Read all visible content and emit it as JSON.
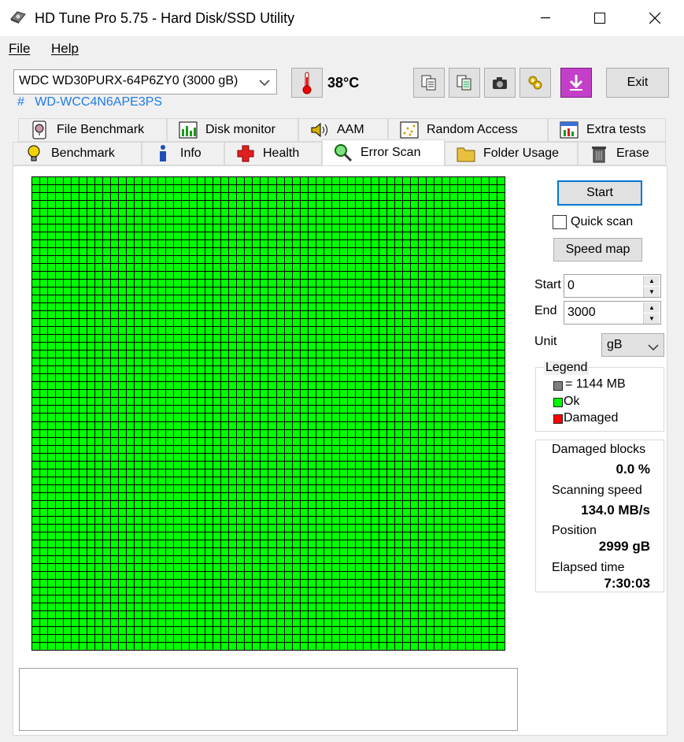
{
  "window": {
    "title": "HD Tune Pro 5.75 - Hard Disk/SSD Utility"
  },
  "menu": {
    "file": "File",
    "help": "Help"
  },
  "drive": {
    "selected": "WDC WD30PURX-64P6ZY0 (3000 gB)",
    "serial_prefix": "#",
    "serial": "WD-WCC4N6APE3PS"
  },
  "temperature": "38°C",
  "toolbar": {
    "exit_label": "Exit"
  },
  "tabs_top": [
    {
      "label": "File Benchmark",
      "icon": "file-benchmark-icon"
    },
    {
      "label": "Disk monitor",
      "icon": "disk-monitor-icon"
    },
    {
      "label": "AAM",
      "icon": "speaker-icon"
    },
    {
      "label": "Random Access",
      "icon": "random-access-icon"
    },
    {
      "label": "Extra tests",
      "icon": "extra-tests-icon"
    }
  ],
  "tabs_bottom": [
    {
      "label": "Benchmark",
      "icon": "lightbulb-icon"
    },
    {
      "label": "Info",
      "icon": "info-icon"
    },
    {
      "label": "Health",
      "icon": "health-cross-icon"
    },
    {
      "label": "Error Scan",
      "icon": "magnifier-icon",
      "active": true
    },
    {
      "label": "Folder Usage",
      "icon": "folder-icon"
    },
    {
      "label": "Erase",
      "icon": "trash-icon"
    }
  ],
  "controls": {
    "start_label": "Start",
    "quick_scan_label": "Quick scan",
    "quick_scan_checked": false,
    "speed_map_label": "Speed map",
    "start_field_label": "Start",
    "start_value": "0",
    "end_field_label": "End",
    "end_value": "3000",
    "unit_label": "Unit",
    "unit_value": "gB"
  },
  "legend": {
    "title": "Legend",
    "items": [
      {
        "label": "= 1144 MB",
        "color": "#808080"
      },
      {
        "label": "Ok",
        "color": "#00ff00"
      },
      {
        "label": "Damaged",
        "color": "#ff0000"
      }
    ]
  },
  "stats": {
    "damaged_blocks_label": "Damaged blocks",
    "damaged_blocks_value": "0.0 %",
    "scanning_speed_label": "Scanning speed",
    "scanning_speed_value": "134.0 MB/s",
    "position_label": "Position",
    "position_value": "2999 gB",
    "elapsed_time_label": "Elapsed time",
    "elapsed_time_value": "7:30:03"
  },
  "scan_map": {
    "rows": 60,
    "cols": 60,
    "ok_fraction": 1.0,
    "ok_color": "#00ff00"
  }
}
